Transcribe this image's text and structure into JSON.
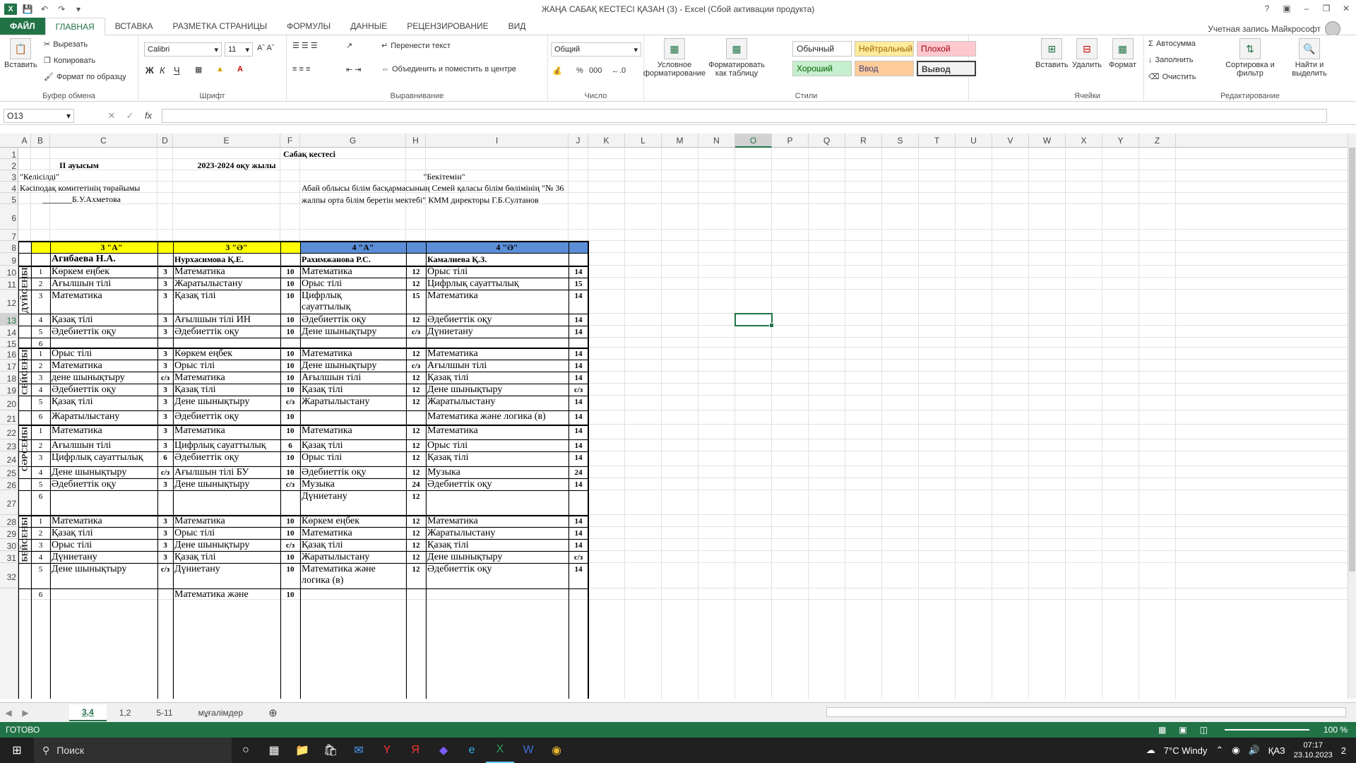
{
  "window": {
    "title": "ЖАҢА САБАҚ КЕСТЕСІ ҚАЗАН (3) - Excel (Сбой активации продукта)",
    "account": "Учетная запись Майкрософт"
  },
  "tabs": [
    "ФАЙЛ",
    "ГЛАВНАЯ",
    "ВСТАВКА",
    "РАЗМЕТКА СТРАНИЦЫ",
    "ФОРМУЛЫ",
    "ДАННЫЕ",
    "РЕЦЕНЗИРОВАНИЕ",
    "ВИД"
  ],
  "ribbon": {
    "clipboard": {
      "paste": "Вставить",
      "cut": "Вырезать",
      "copy": "Копировать",
      "painter": "Формат по образцу",
      "label": "Буфер обмена"
    },
    "font": {
      "name": "Calibri",
      "size": "11",
      "bold": "Ж",
      "italic": "К",
      "underline": "Ч",
      "label": "Шрифт"
    },
    "alignment": {
      "wrap": "Перенести текст",
      "merge": "Объединить и поместить в центре",
      "label": "Выравнивание"
    },
    "number": {
      "format": "Общий",
      "percent": "%",
      "thousands": "000",
      "label": "Число"
    },
    "styles": {
      "cond": "Условное форматирование",
      "astable": "Форматировать как таблицу",
      "normal": "Обычный",
      "neutral": "Нейтральный",
      "bad": "Плохой",
      "good": "Хороший",
      "input": "Ввод",
      "output": "Вывод",
      "label": "Стили"
    },
    "cells": {
      "insert": "Вставить",
      "delete": "Удалить",
      "format": "Формат",
      "label": "Ячейки"
    },
    "editing": {
      "autosum": "Автосумма",
      "fill": "Заполнить",
      "clear": "Очистить",
      "sort": "Сортировка и фильтр",
      "find": "Найти и выделить",
      "label": "Редактирование"
    }
  },
  "formula_bar": {
    "namebox": "O13",
    "fx": "fx",
    "value": ""
  },
  "columns": [
    "A",
    "B",
    "C",
    "D",
    "E",
    "F",
    "G",
    "H",
    "I",
    "J",
    "K",
    "L",
    "M",
    "N",
    "O",
    "P",
    "Q",
    "R",
    "S",
    "T",
    "U",
    "V",
    "W",
    "X",
    "Y",
    "Z"
  ],
  "rows": [
    "1",
    "2",
    "3",
    "4",
    "5",
    "6",
    "7",
    "8",
    "9",
    "10",
    "11",
    "12",
    "13",
    "14",
    "15",
    "16",
    "17",
    "18",
    "19",
    "20",
    "21",
    "22",
    "23",
    "24",
    "25",
    "26",
    "27",
    "28",
    "29",
    "30",
    "31",
    "32"
  ],
  "header": {
    "title": "Сабақ кестесі",
    "shift": "ІІ ауысым",
    "year": "2023-2024 оқу жылы",
    "agreed": "\"Келісілді\"",
    "approved": "\"Бекітемін\"",
    "union": "Кәсіподақ комитетінің төрайымы",
    "union_sig": "_______Б.У.Ахметова",
    "director": "Абай облысы білім басқармасының Семей қаласы білім бөлімінің  \"№ 36 жалпы орта білім беретін мектебі\" КММ директоры Г.Б.Султанов"
  },
  "classes": [
    {
      "name": "3 \"А\"",
      "teacher": "Агибаева Н.А."
    },
    {
      "name": "3 \"Ә\"",
      "teacher": "Нурхасимова Қ.Е."
    },
    {
      "name": "4 \"А\"",
      "teacher": "Рахимжанова Р.С."
    },
    {
      "name": "4 \"Ә\"",
      "teacher": "Камалиева Қ.З."
    }
  ],
  "days": [
    "ДҮЙСЕНБІ",
    "СЕЙСЕНБІ",
    "СӘРСЕНБІ",
    "БЕЙСЕНБІ"
  ],
  "lessons": [
    {
      "row": "10",
      "n": "1",
      "c": "Көркем еңбек",
      "d": "3",
      "e": "Математика",
      "f": "10",
      "g": "Математика",
      "h": "12",
      "i": "Орыс тілі",
      "j": "14"
    },
    {
      "row": "11",
      "n": "2",
      "c": "Ағылшын тілі",
      "d": "3",
      "e": "Жаратылыстану",
      "f": "10",
      "g": "Орыс тілі",
      "h": "12",
      "i": "Цифрлық сауаттылық",
      "j": "15"
    },
    {
      "row": "12",
      "n": "3",
      "c": "Математика",
      "d": "3",
      "e": "Қазақ тілі",
      "f": "10",
      "g": "Цифрлық сауаттылық",
      "h": "15",
      "i": "Математика",
      "j": "14"
    },
    {
      "row": "13",
      "n": "4",
      "c": "Қазақ тілі",
      "d": "3",
      "e": "Ағылшын тілі ИН",
      "f": "10",
      "g": "Әдебиеттік оқу",
      "h": "12",
      "i": "Әдебиеттік оқу",
      "j": "14"
    },
    {
      "row": "14",
      "n": "5",
      "c": "Әдебиеттік оқу",
      "d": "3",
      "e": "Әдебиеттік оқу",
      "f": "10",
      "g": "Дене шынықтыру",
      "h": "с/з",
      "i": "Дүниетану",
      "j": "14"
    },
    {
      "row": "15",
      "n": "6",
      "c": "",
      "d": "",
      "e": "",
      "f": "",
      "g": "",
      "h": "",
      "i": "",
      "j": ""
    },
    {
      "row": "16",
      "n": "1",
      "c": "Орыс тілі",
      "d": "3",
      "e": "Көркем еңбек",
      "f": "10",
      "g": "Математика",
      "h": "12",
      "i": "Математика",
      "j": "14"
    },
    {
      "row": "17",
      "n": "2",
      "c": "Математика",
      "d": "3",
      "e": "Орыс тілі",
      "f": "10",
      "g": "Дене шынықтыру",
      "h": "с/з",
      "i": "Ағылшын тілі",
      "j": "14"
    },
    {
      "row": "18",
      "n": "3",
      "c": "дене шынықтыру",
      "d": "с/з",
      "e": "Математика",
      "f": "10",
      "g": "Ағылшын тілі",
      "h": "12",
      "i": "Қазақ тілі",
      "j": "14"
    },
    {
      "row": "19",
      "n": "4",
      "c": "Әдебиеттік оқу",
      "d": "3",
      "e": "Қазақ тілі",
      "f": "10",
      "g": "Қазақ тілі",
      "h": "12",
      "i": "Дене шынықтыру",
      "j": "с/з"
    },
    {
      "row": "20",
      "n": "5",
      "c": "Қазақ тілі",
      "d": "3",
      "e": "Дене шынықтыру",
      "f": "с/з",
      "g": "Жаратылыстану",
      "h": "12",
      "i": "Жаратылыстану",
      "j": "14"
    },
    {
      "row": "21",
      "n": "6",
      "c": "Жаратылыстану",
      "d": "3",
      "e": "Әдебиеттік оқу",
      "f": "10",
      "g": "",
      "h": "",
      "i": "Математика және логика (в)",
      "j": "14"
    },
    {
      "row": "22",
      "n": "1",
      "c": "Математика",
      "d": "3",
      "e": "Математика",
      "f": "10",
      "g": "Математика",
      "h": "12",
      "i": "Математика",
      "j": "14"
    },
    {
      "row": "23",
      "n": "2",
      "c": "Ағылшын тілі",
      "d": "3",
      "e": "Цифрлық сауаттылық",
      "f": "6",
      "g": "Қазақ тілі",
      "h": "12",
      "i": "Орыс тілі",
      "j": "14"
    },
    {
      "row": "24",
      "n": "3",
      "c": "Цифрлық сауаттылық",
      "d": "6",
      "e": "Әдебиеттік оқу",
      "f": "10",
      "g": "Орыс тілі",
      "h": "12",
      "i": "Қазақ тілі",
      "j": "14"
    },
    {
      "row": "25",
      "n": "4",
      "c": "Дене шынықтыру",
      "d": "с/з",
      "e": "Ағылшын тілі БУ",
      "f": "10",
      "g": "Әдебиеттік оқу",
      "h": "12",
      "i": "Музыка",
      "j": "24"
    },
    {
      "row": "26",
      "n": "5",
      "c": "Әдебиеттік оқу",
      "d": "3",
      "e": "Дене шынықтыру",
      "f": "с/з",
      "g": "Музыка",
      "h": "24",
      "i": "Әдебиеттік оқу",
      "j": "14"
    },
    {
      "row": "27",
      "n": "6",
      "c": "",
      "d": "",
      "e": "",
      "f": "",
      "g": "Дүниетану",
      "h": "12",
      "i": "",
      "j": ""
    },
    {
      "row": "28",
      "n": "1",
      "c": "Математика",
      "d": "3",
      "e": "Математика",
      "f": "10",
      "g": "Көркем еңбек",
      "h": "12",
      "i": "Математика",
      "j": "14"
    },
    {
      "row": "29",
      "n": "2",
      "c": "Қазақ тілі",
      "d": "3",
      "e": "Орыс тілі",
      "f": "10",
      "g": "Математика",
      "h": "12",
      "i": "Жаратылыстану",
      "j": "14"
    },
    {
      "row": "30",
      "n": "3",
      "c": "Орыс тілі",
      "d": "3",
      "e": "Дене шынықтыру",
      "f": "с/з",
      "g": "Қазақ тілі",
      "h": "12",
      "i": "Қазақ тілі",
      "j": "14"
    },
    {
      "row": "31",
      "n": "4",
      "c": "Дүниетану",
      "d": "3",
      "e": "Қазақ тілі",
      "f": "10",
      "g": "Жаратылыстану",
      "h": "12",
      "i": "Дене шынықтыру",
      "j": "с/з"
    },
    {
      "row": "32",
      "n": "5",
      "c": "Дене шынықтыру",
      "d": "с/з",
      "e": "Дүниетану",
      "f": "10",
      "g": "Математика және логика (в)",
      "h": "12",
      "i": "Әдебиеттік оқу",
      "j": "14"
    },
    {
      "row": "33",
      "n": "6",
      "c": "",
      "d": "",
      "e": "Математика және",
      "f": "10",
      "g": "",
      "h": "",
      "i": "",
      "j": ""
    }
  ],
  "sheet_tabs": [
    "3,4",
    "1,2",
    "5-11",
    "мұғалімдер"
  ],
  "status": {
    "ready": "ГОТОВО",
    "zoom": "100 %"
  },
  "taskbar": {
    "search": "Поиск",
    "weather": "7°C  Windy",
    "lang": "ҚАЗ",
    "time": "07:17",
    "date": "23.10.2023",
    "notif": "2"
  },
  "colors": {
    "excel_green": "#217346",
    "yellow": "#ffff00",
    "blue": "#5b8ed6"
  }
}
